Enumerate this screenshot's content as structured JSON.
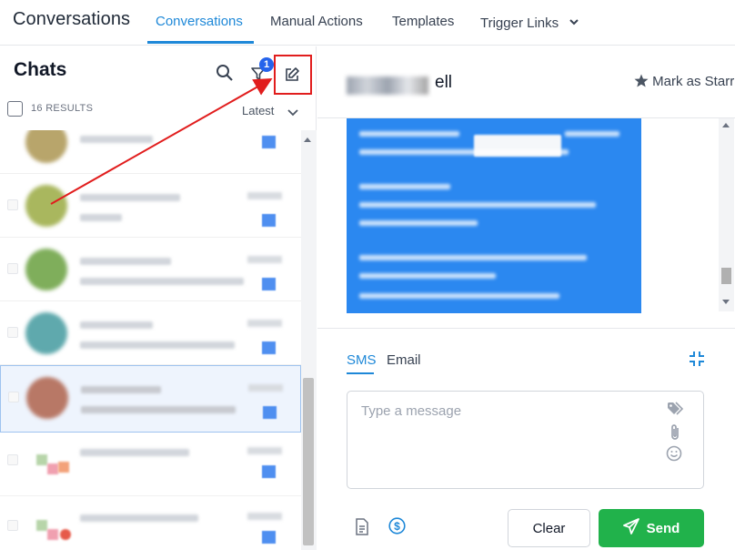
{
  "app": {
    "title": "Conversations"
  },
  "nav": {
    "tabs": [
      {
        "label": "Conversations",
        "active": true
      },
      {
        "label": "Manual Actions",
        "active": false
      },
      {
        "label": "Templates",
        "active": false
      },
      {
        "label": "Trigger Links",
        "active": false
      }
    ]
  },
  "chats": {
    "title": "Chats",
    "filter_badge": "1",
    "results_label": "16 RESULTS",
    "sort_label": "Latest"
  },
  "conversation": {
    "contact_name_visible": "ell",
    "star_label": "Mark as Starr"
  },
  "composer": {
    "tabs": [
      {
        "label": "SMS",
        "active": true
      },
      {
        "label": "Email",
        "active": false
      }
    ],
    "placeholder": "Type a message",
    "clear_label": "Clear",
    "send_label": "Send"
  },
  "colors": {
    "accent": "#1e88d8",
    "send": "#21b24b",
    "message_bubble": "#2b88f0",
    "badge": "#2563eb",
    "annotation": "#e11d1d"
  },
  "icons": [
    "search-icon",
    "filter-icon",
    "compose-icon",
    "star-icon",
    "collapse-icon",
    "tag-icon",
    "attachment-icon",
    "emoji-icon",
    "template-icon",
    "payment-icon",
    "send-icon"
  ]
}
